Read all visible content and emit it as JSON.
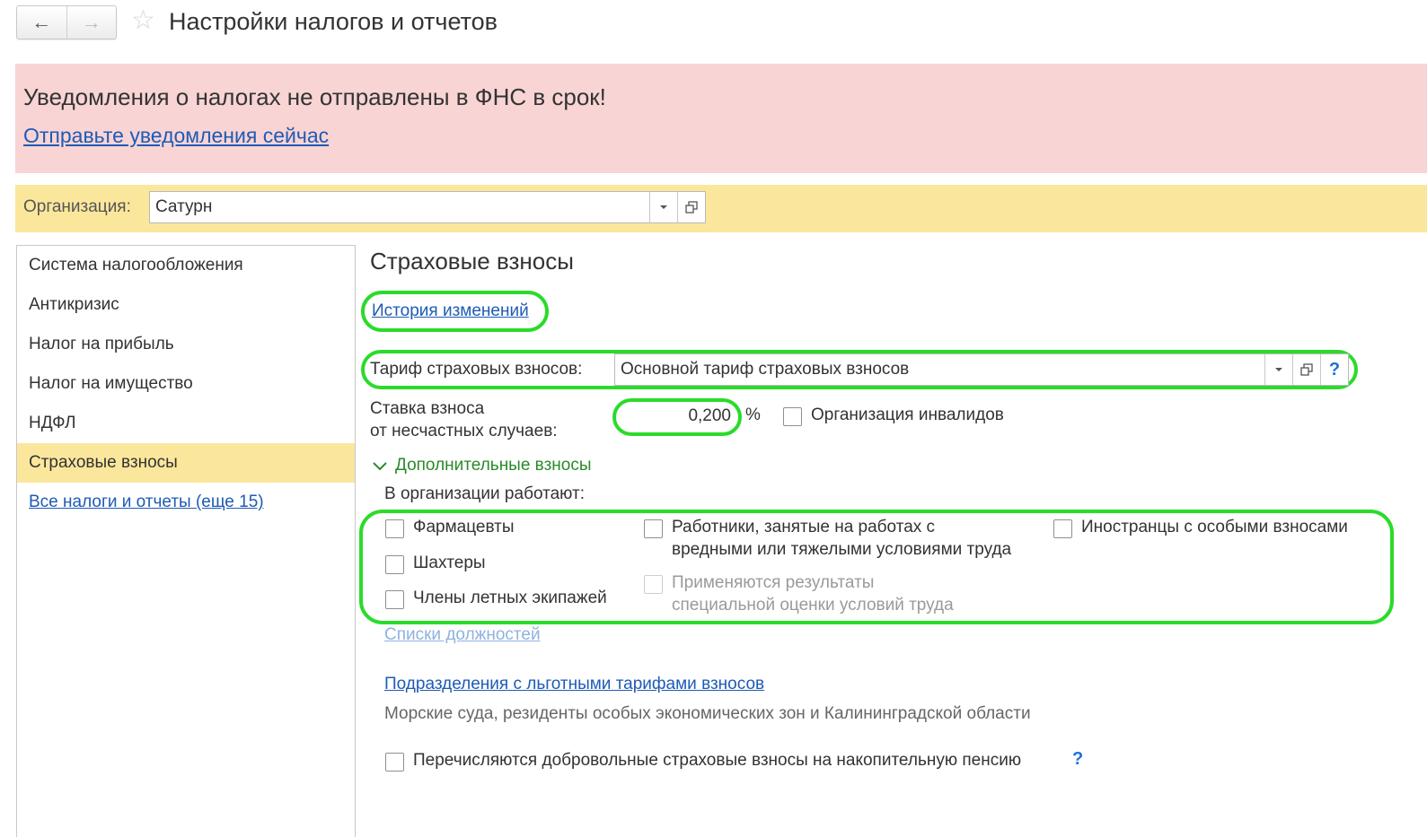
{
  "window": {
    "title": "Настройки налогов и отчетов",
    "back_icon": "←",
    "forward_icon": "→",
    "star_icon": "☆"
  },
  "alert": {
    "message": "Уведомления о налогах не отправлены в ФНС в срок!",
    "link": "Отправьте уведомления сейчас",
    "bg_color": "#f9d4d4"
  },
  "organization": {
    "label": "Организация:",
    "value": "Сатурн",
    "bg_color": "#fbe79c"
  },
  "sidebar": {
    "items": [
      {
        "label": "Система налогообложения"
      },
      {
        "label": "Антикризис"
      },
      {
        "label": "Налог на прибыль"
      },
      {
        "label": "Налог на имущество"
      },
      {
        "label": "НДФЛ"
      },
      {
        "label": "Страховые взносы"
      }
    ],
    "active_index": 5,
    "all_link": "Все налоги и отчеты (еще 15)"
  },
  "main": {
    "title": "Страховые взносы",
    "history_link": "История изменений",
    "tariff": {
      "label": "Тариф страховых взносов:",
      "value": "Основной тариф страховых взносов",
      "help": "?"
    },
    "rate": {
      "label_line1": "Ставка взноса",
      "label_line2": "от несчастных случаев:",
      "value": "0,200",
      "unit": "%"
    },
    "disabled_org": {
      "label": "Организация инвалидов",
      "checked": false
    },
    "additional": {
      "toggle_label": "Дополнительные взносы",
      "expanded": true,
      "employees_label": "В организации работают:",
      "col1": [
        {
          "label": "Фармацевты",
          "checked": false
        },
        {
          "label": "Шахтеры",
          "checked": false
        },
        {
          "label": "Члены летных экипажей",
          "checked": false
        }
      ],
      "hazardous": {
        "line1": "Работники, занятые на работах с",
        "line2": "вредными или тяжелыми условиями труда",
        "checked": false
      },
      "sout": {
        "line1": "Применяются результаты",
        "line2": "специальной оценки условий труда",
        "checked": false,
        "disabled": true
      },
      "foreigners": {
        "label": "Иностранцы с особыми взносами",
        "checked": false
      },
      "positions_link": "Списки должностей"
    },
    "subdivisions": {
      "link": "Подразделения с льготными тарифами взносов",
      "note": "Морские суда, резиденты особых экономических зон и Калининградской области"
    },
    "voluntary": {
      "label": "Перечисляются добровольные страховые взносы на накопительную пенсию",
      "help": "?",
      "checked": false
    }
  },
  "highlight_color": "#2bdb2b"
}
